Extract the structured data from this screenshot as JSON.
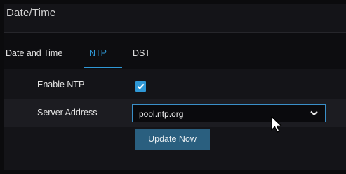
{
  "window": {
    "title": "Date/Time"
  },
  "tabs": [
    {
      "label": "Date and Time",
      "active": false
    },
    {
      "label": "NTP",
      "active": true
    },
    {
      "label": "DST",
      "active": false
    }
  ],
  "form": {
    "enable_ntp": {
      "label": "Enable NTP",
      "checked": true
    },
    "server_address": {
      "label": "Server Address",
      "value": "pool.ntp.org"
    },
    "update_button": "Update Now"
  },
  "colors": {
    "accent": "#2f98d6",
    "button": "#2a5f7f",
    "background": "#141418"
  },
  "icons": {
    "checkbox": "check-icon",
    "dropdown": "chevron-down-icon",
    "pointer": "mouse-cursor-icon"
  }
}
